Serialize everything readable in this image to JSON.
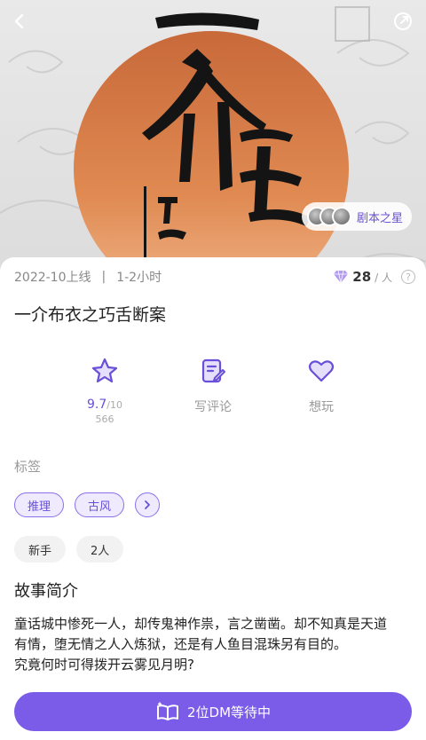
{
  "header": {
    "back_icon": "chevron-left-icon",
    "share_icon": "share-icon",
    "club": {
      "name": "剧本之星"
    }
  },
  "meta": {
    "launch": "2022-10上线",
    "separator": "|",
    "duration": "1-2小时",
    "price": "28",
    "price_unit": "/ 人",
    "price_icon": "diamond-icon",
    "help": "?"
  },
  "title": "一介布衣之巧舌断案",
  "actions": {
    "rating": {
      "icon": "star-icon",
      "score": "9.7",
      "out_of": "/10",
      "count": "566"
    },
    "review": {
      "icon": "edit-icon",
      "label": "写评论"
    },
    "want": {
      "icon": "heart-icon",
      "label": "想玩"
    }
  },
  "tags_section": {
    "label": "标签",
    "primary": [
      "推理",
      "古风"
    ],
    "secondary": [
      "新手",
      "2人"
    ]
  },
  "intro": {
    "title": "故事简介",
    "lines": [
      "童话城中惨死一人，却传鬼神作祟，言之凿凿。却不知真是天道",
      "有情，堕无情之人入炼狱，还是有人鱼目混珠另有目的。",
      "究竟何时可得拨开云雾见月明?"
    ]
  },
  "cta": {
    "label": "2位DM等待中",
    "icon": "book-icon"
  },
  "colors": {
    "accent": "#7b5ce8",
    "tag_bg": "#efeafd",
    "sun": "#d9804a"
  }
}
